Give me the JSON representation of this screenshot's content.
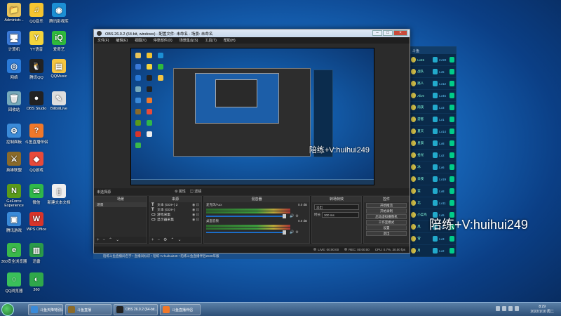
{
  "desktop_icons": [
    {
      "label": "Administr...",
      "glyph": "📁",
      "color": "#e8c35a"
    },
    {
      "label": "QQ音乐",
      "glyph": "♫",
      "color": "#f4c430"
    },
    {
      "label": "腾讯影视库",
      "glyph": "◉",
      "color": "#1c8fd4"
    },
    {
      "label": "计算机",
      "glyph": "🖥",
      "color": "#3b7ad8"
    },
    {
      "label": "YY语音",
      "glyph": "Y",
      "color": "#f4d43c"
    },
    {
      "label": "爱奇艺",
      "glyph": "iQ",
      "color": "#2fba3c"
    },
    {
      "label": "网络",
      "glyph": "◎",
      "color": "#2a7ad8"
    },
    {
      "label": "腾讯QQ",
      "glyph": "🐧",
      "color": "#222"
    },
    {
      "label": "QQMusic",
      "glyph": "▤",
      "color": "#f5c542"
    },
    {
      "label": "回收站",
      "glyph": "🗑",
      "color": "#7ab"
    },
    {
      "label": "OBS Studio",
      "glyph": "●",
      "color": "#222"
    },
    {
      "label": "BilibiliLive",
      "glyph": "✎",
      "color": "#ddd"
    },
    {
      "label": "控制面板",
      "glyph": "⚙",
      "color": "#3a8ad8"
    },
    {
      "label": "斗鱼直播伴侣",
      "glyph": "?",
      "color": "#f0782a"
    },
    {
      "label": "英雄联盟",
      "glyph": "⚔",
      "color": "#8a6a2a"
    },
    {
      "label": "QQ游戏",
      "glyph": "◆",
      "color": "#e84a3a"
    },
    {
      "label": "GeForce Experience",
      "glyph": "N",
      "color": "#5a9a1a"
    },
    {
      "label": "微信",
      "glyph": "✉",
      "color": "#2fb84a"
    },
    {
      "label": "新建文本文档",
      "glyph": "▯",
      "color": "#eee"
    },
    {
      "label": "腾讯游戏",
      "glyph": "▣",
      "color": "#3a8ad8"
    },
    {
      "label": "WPS Office",
      "glyph": "W",
      "color": "#d8342a"
    },
    {
      "label": "360安全浏览器",
      "glyph": "e",
      "color": "#3ab84a"
    },
    {
      "label": "迅雷",
      "glyph": "▥",
      "color": "#2a9a4a"
    },
    {
      "label": "QQ浏览器",
      "glyph": "◌",
      "color": "#3ac05a"
    },
    {
      "label": "360",
      "glyph": "◐",
      "color": "#2fa84a"
    }
  ],
  "obs": {
    "title": "OBS 26.0.2 (64-bit, windows) - 配置文件: 未命名 - 场景: 未命名",
    "menu": [
      "文件(F)",
      "编辑(E)",
      "视图(V)",
      "停靠部件(D)",
      "场景集合(S)",
      "工具(T)",
      "帮助(H)"
    ],
    "scene_bar_label": "未选择源",
    "scene_bar_props": "⚙ 属性",
    "scene_bar_filters": "▤ 滤镜",
    "preview_watermark": "陪练+V:huihui249",
    "panels": {
      "scenes": {
        "header": "场景",
        "items": [
          "场景"
        ]
      },
      "sources": {
        "header": "来源",
        "items": [
          {
            "type": "T",
            "label": "文本 (GDI+) 2"
          },
          {
            "type": "T",
            "label": "文本 (GDI+)"
          },
          {
            "type": "▭",
            "label": "游戏采集"
          },
          {
            "type": "▭",
            "label": "显示器采集"
          }
        ]
      },
      "mixer": {
        "header": "混音器",
        "tracks": [
          {
            "name": "麦克风/Aux",
            "level": "0.0 dB"
          },
          {
            "name": "桌面音频",
            "level": "0.0 dB"
          }
        ]
      },
      "transitions": {
        "header": "转场特效",
        "effect": "淡出",
        "duration_label": "时长",
        "duration": "300 ms"
      },
      "controls": {
        "header": "控件",
        "buttons": [
          "开始推流",
          "开始录制",
          "启动虚拟摄像机",
          "工作室模式",
          "设置",
          "退出"
        ]
      }
    },
    "status": {
      "live": "LIVE: 00:00:00",
      "rec": "REC: 00:00:00",
      "cpu": "CPU: 0.7%, 30.00 fps"
    },
    "bottom_strip": "陪练斗鱼直播间名字 • 直播间标识 • 陪练+V:huihui249 • 陪练斗鱼直播伴侣2020年版"
  },
  "side_app": {
    "header": "斗鱼",
    "rows": [
      {
        "name": "Lv45",
        "tag": "LV22"
      },
      {
        "name": "战队",
        "tag": "Lv5"
      },
      {
        "name": "路人",
        "tag": "Lv12"
      },
      {
        "name": "Alive",
        "tag": "Lv45"
      },
      {
        "name": "雨夜",
        "tag": "Lv3"
      },
      {
        "name": "游客",
        "tag": "Lv1"
      },
      {
        "name": "夏天",
        "tag": "Lv14"
      },
      {
        "name": "星辰",
        "tag": "Lv8"
      },
      {
        "name": "拾光",
        "tag": "Lv2"
      },
      {
        "name": "冰",
        "tag": "Lv6"
      },
      {
        "name": "白夜",
        "tag": "Lv19"
      },
      {
        "name": "蓝",
        "tag": "Lv8"
      },
      {
        "name": "北",
        "tag": "Lv11"
      },
      {
        "name": "小菜鸟",
        "tag": "Lv5"
      },
      {
        "name": "风",
        "tag": "Lv4"
      },
      {
        "name": "雪",
        "tag": "Lv3"
      },
      {
        "name": "月",
        "tag": "Lv2"
      }
    ]
  },
  "watermark": "陪练+V:huihui249",
  "taskbar": {
    "buttons": [
      {
        "label": "斗鱼天降特别通道_B...",
        "color": "#3a8ad8"
      },
      {
        "label": "斗鱼直播",
        "color": "#8a6a2a"
      },
      {
        "label": "OBS 26.0.2 (64-bit...",
        "color": "#222"
      },
      {
        "label": "斗鱼直播伴侣",
        "color": "#f0782a"
      }
    ],
    "time": "8:29",
    "date": "2022/1/10 周二"
  }
}
